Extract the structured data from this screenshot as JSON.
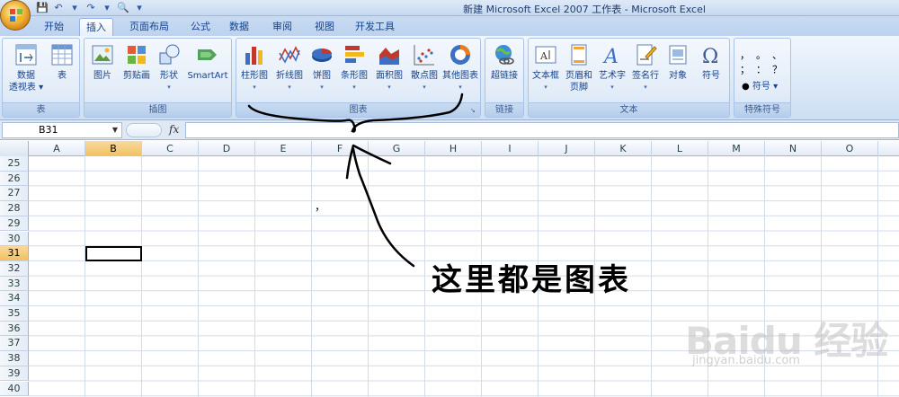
{
  "window": {
    "title": "新建 Microsoft Excel 2007 工作表 - Microsoft Excel"
  },
  "quick_access": [
    {
      "icon": "save-icon",
      "glyph": "💾"
    },
    {
      "icon": "undo-icon",
      "glyph": "↶"
    },
    {
      "icon": "undo-dropdown-icon",
      "glyph": "▾"
    },
    {
      "icon": "redo-icon",
      "glyph": "↷"
    },
    {
      "icon": "redo-dropdown-icon",
      "glyph": "▾"
    },
    {
      "icon": "print-preview-icon",
      "glyph": "🔍"
    },
    {
      "icon": "customize-qat-icon",
      "glyph": "▾"
    }
  ],
  "tabs": [
    {
      "label": "开始",
      "active": false
    },
    {
      "label": "插入",
      "active": true
    },
    {
      "label": "页面布局",
      "active": false
    },
    {
      "label": "公式",
      "active": false
    },
    {
      "label": "数据",
      "active": false
    },
    {
      "label": "审阅",
      "active": false
    },
    {
      "label": "视图",
      "active": false
    },
    {
      "label": "开发工具",
      "active": false
    }
  ],
  "ribbon": {
    "groups": {
      "tables": {
        "label": "表",
        "buttons": [
          {
            "label1": "数据",
            "label2": "透视表 ▾",
            "icon": "pivot-table-icon"
          },
          {
            "label1": "表",
            "label2": "",
            "icon": "table-icon"
          }
        ]
      },
      "illustrations": {
        "label": "插图",
        "buttons": [
          {
            "label1": "图片",
            "icon": "picture-icon"
          },
          {
            "label1": "剪贴画",
            "icon": "clip-art-icon"
          },
          {
            "label1": "形状",
            "icon": "shapes-icon",
            "dropdown": "▾"
          },
          {
            "label1": "SmartArt",
            "icon": "smartart-icon"
          }
        ]
      },
      "charts": {
        "label": "图表",
        "buttons": [
          {
            "label1": "柱形图",
            "icon": "column-chart-icon",
            "dropdown": "▾"
          },
          {
            "label1": "折线图",
            "icon": "line-chart-icon",
            "dropdown": "▾"
          },
          {
            "label1": "饼图",
            "icon": "pie-chart-icon",
            "dropdown": "▾"
          },
          {
            "label1": "条形图",
            "icon": "bar-chart-icon",
            "dropdown": "▾"
          },
          {
            "label1": "面积图",
            "icon": "area-chart-icon",
            "dropdown": "▾"
          },
          {
            "label1": "散点图",
            "icon": "scatter-chart-icon",
            "dropdown": "▾"
          },
          {
            "label1": "其他图表",
            "icon": "other-charts-icon",
            "dropdown": "▾"
          }
        ]
      },
      "links": {
        "label": "链接",
        "buttons": [
          {
            "label1": "超链接",
            "icon": "hyperlink-icon"
          }
        ]
      },
      "text": {
        "label": "文本",
        "buttons": [
          {
            "label1": "文本框",
            "icon": "textbox-icon",
            "dropdown": "▾"
          },
          {
            "label1": "页眉和",
            "label2": "页脚",
            "icon": "header-footer-icon"
          },
          {
            "label1": "艺术字",
            "icon": "wordart-icon",
            "dropdown": "▾"
          },
          {
            "label1": "签名行",
            "icon": "signature-line-icon",
            "dropdown": "▾"
          },
          {
            "label1": "对象",
            "icon": "object-icon"
          },
          {
            "label1": "符号",
            "icon": "symbol-icon"
          }
        ]
      },
      "special_symbols": {
        "label": "特殊符号",
        "row1": "，  。  、",
        "row2": "；  ：  ？",
        "symbol_button": "符号 ▾"
      }
    }
  },
  "formula_bar": {
    "name_box": "B31",
    "fx_label": "fx",
    "formula": ""
  },
  "sheet": {
    "columns": [
      "A",
      "B",
      "C",
      "D",
      "E",
      "F",
      "G",
      "H",
      "I",
      "J",
      "K",
      "L",
      "M",
      "N",
      "O"
    ],
    "rows": [
      "25",
      "26",
      "27",
      "28",
      "29",
      "30",
      "31",
      "32",
      "33",
      "34",
      "35",
      "36",
      "37",
      "38",
      "39",
      "40"
    ],
    "selected_column": "B",
    "selected_row": "31",
    "stray_mark": "，"
  },
  "annotation": {
    "text": "这里都是图表",
    "color": "#000000"
  },
  "watermark": {
    "logo": "Baidu 经验",
    "url": "jingyan.baidu.com"
  },
  "colors": {
    "ribbon_bg": "#dbe8f7",
    "tab_text": "#15428b",
    "selected_header": "#f1c15f"
  }
}
